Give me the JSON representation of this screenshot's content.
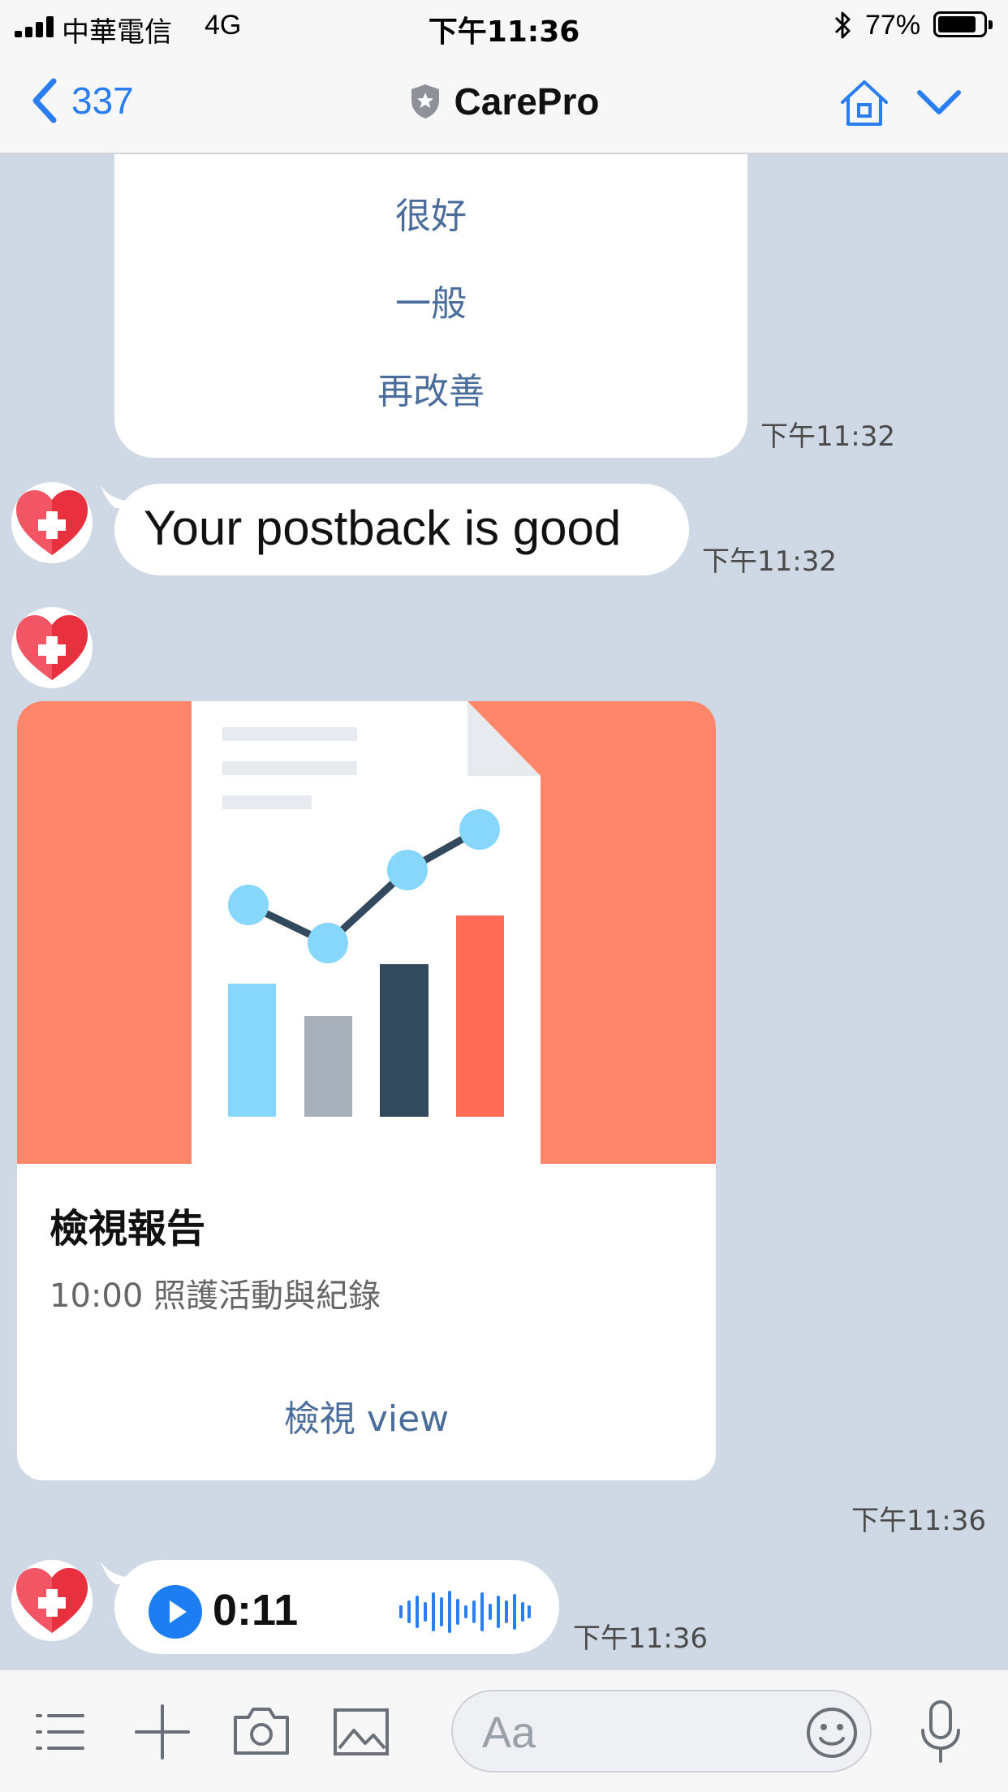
{
  "status_bar": {
    "carrier": "中華電信",
    "network": "4G",
    "time": "下午11:36",
    "battery_percent": "77%",
    "battery_level": 0.77
  },
  "nav": {
    "back_count": "337",
    "title": "CarePro",
    "icons": [
      "back-chevron-icon",
      "shield-star-icon",
      "home-icon",
      "chevron-down-icon"
    ]
  },
  "chat": {
    "quick_reply": {
      "options": [
        "很好",
        "一般",
        "再改善"
      ],
      "time": "下午11:32"
    },
    "text_message": {
      "text": "Your postback is good",
      "time": "下午11:32"
    },
    "card": {
      "title": "檢視報告",
      "subtitle": "10:00 照護活動與紀錄",
      "action_label": "檢視 view",
      "time": "下午11:36"
    },
    "voice_message": {
      "duration": "0:11",
      "time": "下午11:36"
    }
  },
  "input_bar": {
    "placeholder": "Aa",
    "icons": [
      "menu-icon",
      "plus-icon",
      "camera-icon",
      "image-icon",
      "emoji-icon",
      "microphone-icon"
    ]
  },
  "colors": {
    "accent": "#2a7ef1",
    "chat_background": "#cfd9e5",
    "card_hero": "#ff866a",
    "link_text": "#4b6d9c"
  }
}
